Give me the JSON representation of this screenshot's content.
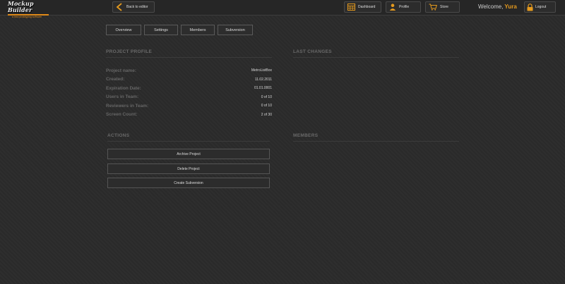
{
  "logo": {
    "title": "Mockup Builder",
    "tagline": "a lean prototyping software"
  },
  "header": {
    "back_label": "Back to editor",
    "nav": [
      {
        "label": "Dashboard",
        "icon": "calendar-grid-icon"
      },
      {
        "label": "Profile",
        "icon": "person-icon"
      },
      {
        "label": "Store",
        "icon": "cart-icon"
      }
    ],
    "welcome_label": "Welcome,",
    "username": "Yura",
    "logout_label": "Logout"
  },
  "tabs": [
    "Overview",
    "Settings",
    "Members",
    "Subversion"
  ],
  "profile": {
    "title": "PROJECT PROFILE",
    "rows": [
      {
        "label": "Project name:",
        "value": "MetroListBox"
      },
      {
        "label": "Created:",
        "value": "11.02.2011"
      },
      {
        "label": "Expiration Date:",
        "value": "01.01.0001"
      },
      {
        "label": "Users in Team:",
        "value": "0 of 10"
      },
      {
        "label": "Reviewers in Team:",
        "value": "0 of 10"
      },
      {
        "label": "Screen Count:",
        "value": "2 of 30"
      }
    ]
  },
  "last_changes": {
    "title": "LAST CHANGES"
  },
  "actions": {
    "title": "ACTIONS",
    "buttons": [
      "Archive Project",
      "Delete Project",
      "Create Subversion"
    ]
  },
  "members": {
    "title": "MEMBERS"
  },
  "colors": {
    "accent": "#e59a1e",
    "background": "#2b2b2b",
    "section_title": "#6a6a6a"
  }
}
